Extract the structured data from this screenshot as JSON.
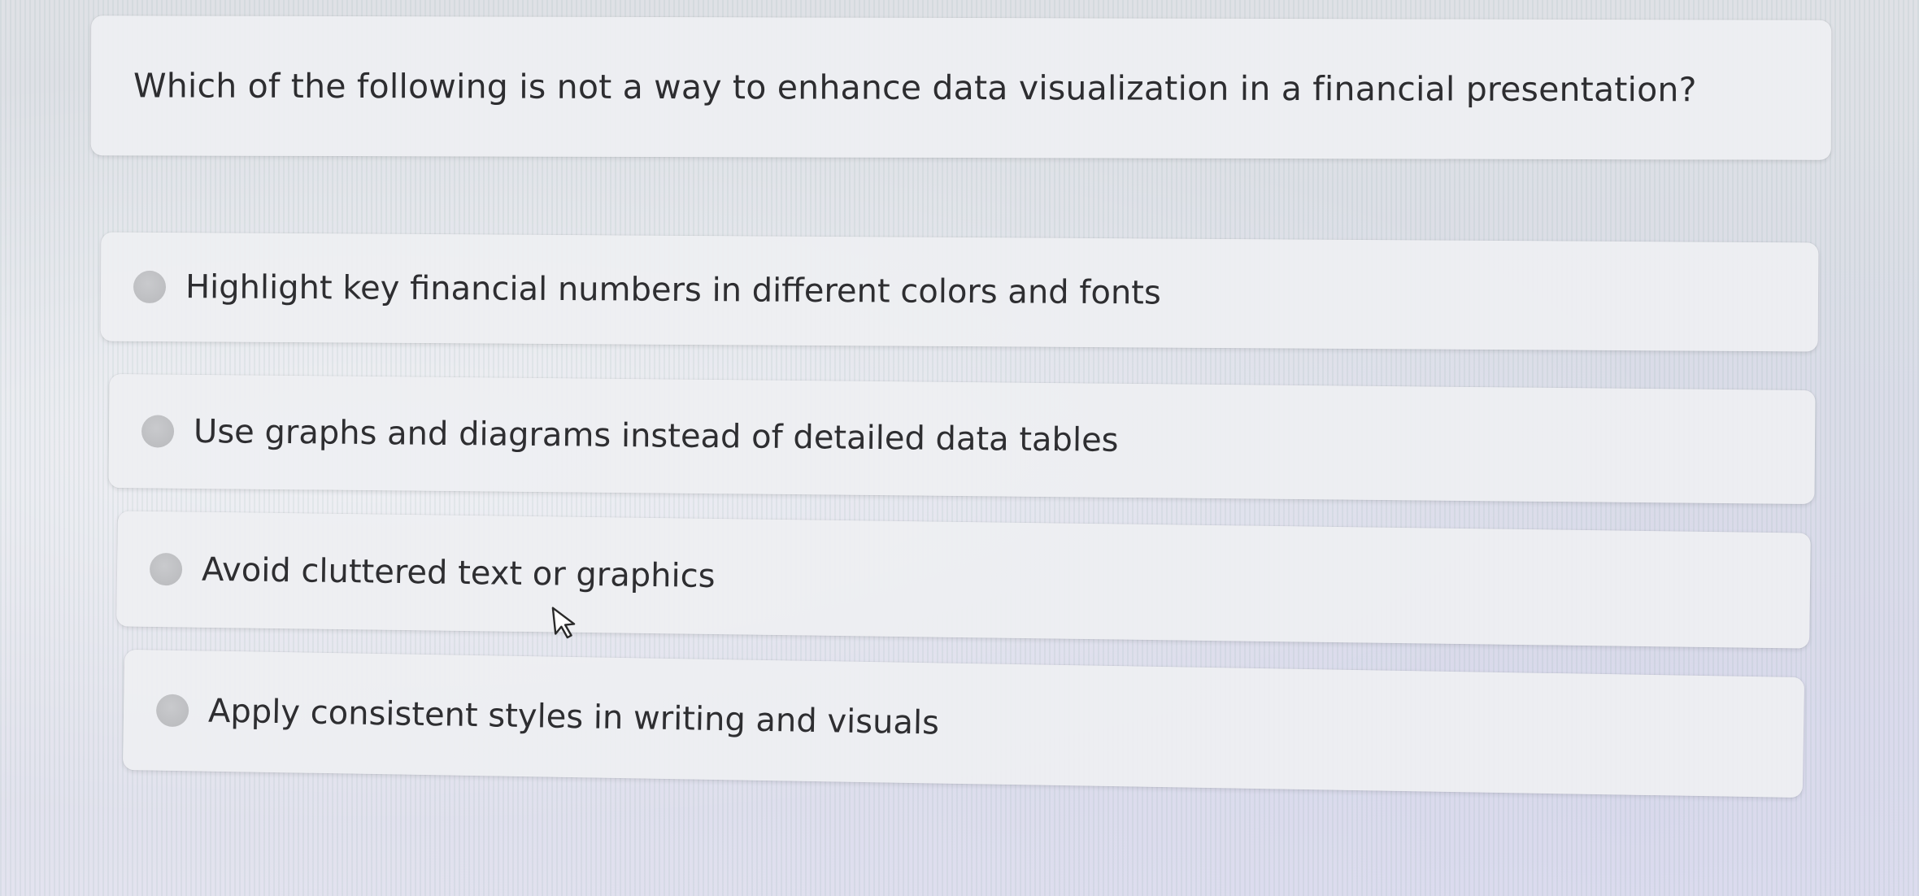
{
  "question": {
    "text": "Which of the following is not a way to enhance data visualization in a financial presentation?"
  },
  "options": [
    {
      "label": "Highlight key financial numbers in different colors and fonts",
      "selected": false
    },
    {
      "label": "Use graphs and diagrams instead of detailed data tables",
      "selected": false
    },
    {
      "label": "Avoid cluttered text or graphics",
      "selected": false
    },
    {
      "label": "Apply consistent styles in writing and visuals",
      "selected": false
    }
  ],
  "colors": {
    "card_background": "#eeeff2",
    "radio_fill": "#b8b9bc",
    "text": "#2e2e31"
  },
  "icons": {
    "cursor": "mouse-pointer-icon"
  }
}
